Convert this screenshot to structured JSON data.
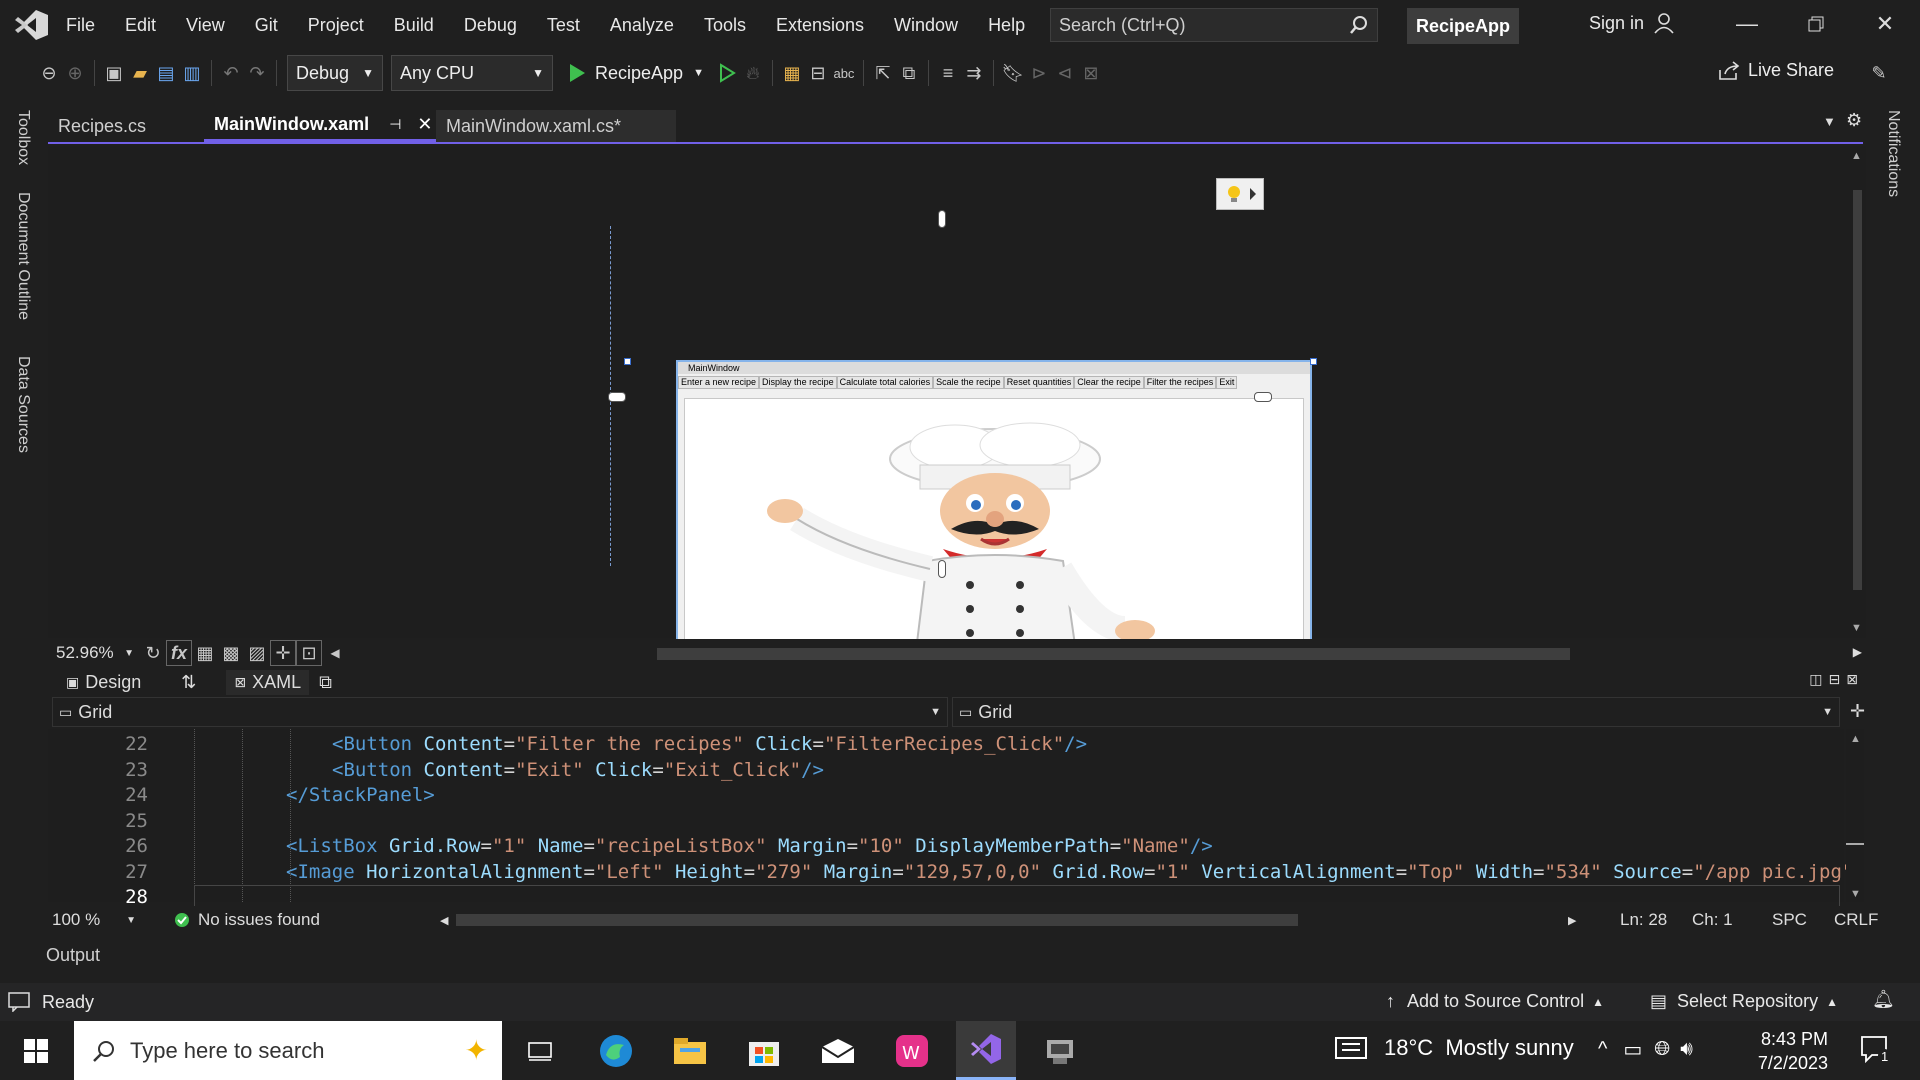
{
  "title_bar": {
    "menu": [
      "File",
      "Edit",
      "View",
      "Git",
      "Project",
      "Build",
      "Debug",
      "Test",
      "Analyze",
      "Tools",
      "Extensions",
      "Window",
      "Help"
    ],
    "search_placeholder": "Search (Ctrl+Q)",
    "project_name": "RecipeApp",
    "sign_in": "Sign in"
  },
  "toolbar": {
    "configuration": "Debug",
    "platform": "Any CPU",
    "run_target": "RecipeApp",
    "live_share": "Live Share"
  },
  "left_rail": [
    "Toolbox",
    "Document Outline",
    "Data Sources"
  ],
  "right_rail": [
    "Notifications"
  ],
  "tabs": [
    {
      "label": "Recipes.cs",
      "active": false
    },
    {
      "label": "MainWindow.xaml",
      "active": true
    },
    {
      "label": "MainWindow.xaml.cs*",
      "active": false
    }
  ],
  "designer": {
    "window_title": "MainWindow",
    "buttons": [
      "Enter a new recipe",
      "Display the recipe",
      "Calculate total calories",
      "Scale the recipe",
      "Reset quantities",
      "Clear the recipe",
      "Filter the recipes",
      "Exit"
    ],
    "zoom": "52.96%"
  },
  "view_tabs": {
    "design": "Design",
    "xaml": "XAML"
  },
  "selectors": {
    "left": "Grid",
    "right": "Grid"
  },
  "code": {
    "lines": [
      {
        "n": "22",
        "indent": 4,
        "parts": [
          [
            "kw",
            "<"
          ],
          [
            "kw",
            "Button "
          ],
          [
            "at",
            "Content"
          ],
          [
            "tx",
            "="
          ],
          [
            "st",
            "\"Filter the recipes\""
          ],
          [
            "at",
            " Click"
          ],
          [
            "tx",
            "="
          ],
          [
            "st",
            "\"FilterRecipes_Click\""
          ],
          [
            "kw",
            "/>"
          ]
        ]
      },
      {
        "n": "23",
        "indent": 4,
        "parts": [
          [
            "kw",
            "<"
          ],
          [
            "kw",
            "Button "
          ],
          [
            "at",
            "Content"
          ],
          [
            "tx",
            "="
          ],
          [
            "st",
            "\"Exit\""
          ],
          [
            "at",
            " Click"
          ],
          [
            "tx",
            "="
          ],
          [
            "st",
            "\"Exit_Click\""
          ],
          [
            "kw",
            "/>"
          ]
        ]
      },
      {
        "n": "24",
        "indent": 3,
        "parts": [
          [
            "kw",
            "</"
          ],
          [
            "kw",
            "StackPanel"
          ],
          [
            "kw",
            ">"
          ]
        ]
      },
      {
        "n": "25",
        "indent": 0,
        "parts": []
      },
      {
        "n": "26",
        "indent": 3,
        "parts": [
          [
            "kw",
            "<"
          ],
          [
            "kw",
            "ListBox "
          ],
          [
            "at",
            "Grid.Row"
          ],
          [
            "tx",
            "="
          ],
          [
            "st",
            "\"1\""
          ],
          [
            "at",
            " Name"
          ],
          [
            "tx",
            "="
          ],
          [
            "st",
            "\"recipeListBox\""
          ],
          [
            "at",
            " Margin"
          ],
          [
            "tx",
            "="
          ],
          [
            "st",
            "\"10\""
          ],
          [
            "at",
            " DisplayMemberPath"
          ],
          [
            "tx",
            "="
          ],
          [
            "st",
            "\"Name\""
          ],
          [
            "kw",
            "/>"
          ]
        ]
      },
      {
        "n": "27",
        "indent": 3,
        "parts": [
          [
            "kw",
            "<"
          ],
          [
            "kw",
            "Image "
          ],
          [
            "at",
            "HorizontalAlignment"
          ],
          [
            "tx",
            "="
          ],
          [
            "st",
            "\"Left\""
          ],
          [
            "at",
            " Height"
          ],
          [
            "tx",
            "="
          ],
          [
            "st",
            "\"279\""
          ],
          [
            "at",
            " Margin"
          ],
          [
            "tx",
            "="
          ],
          [
            "st",
            "\"129,57,0,0\""
          ],
          [
            "at",
            " Grid.Row"
          ],
          [
            "tx",
            "="
          ],
          [
            "st",
            "\"1\""
          ],
          [
            "at",
            " VerticalAlignment"
          ],
          [
            "tx",
            "="
          ],
          [
            "st",
            "\"Top\""
          ],
          [
            "at",
            " Width"
          ],
          [
            "tx",
            "="
          ],
          [
            "st",
            "\"534\""
          ],
          [
            "at",
            " Source"
          ],
          [
            "tx",
            "="
          ],
          [
            "st",
            "\"/app pic.jpg\""
          ]
        ]
      },
      {
        "n": "28",
        "indent": 0,
        "parts": []
      }
    ]
  },
  "editor_status": {
    "zoom": "100 %",
    "issues": "No issues found",
    "ln": "Ln: 28",
    "ch": "Ch: 1",
    "spc": "SPC",
    "crlf": "CRLF"
  },
  "output_label": "Output",
  "status_bar": {
    "ready": "Ready",
    "add_source": "Add to Source Control",
    "select_repo": "Select Repository"
  },
  "taskbar": {
    "search_placeholder": "Type here to search",
    "weather": "18°C  Mostly sunny",
    "time": "8:43 PM",
    "date": "7/2/2023",
    "notifications": "1"
  },
  "colors": {
    "accent": "#7160e8",
    "run_green": "#3fbf4f",
    "designer_border": "#86b4ea"
  }
}
